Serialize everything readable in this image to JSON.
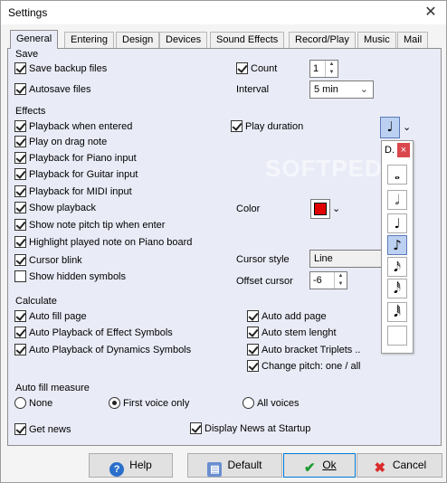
{
  "window": {
    "title": "Settings"
  },
  "tabs": [
    "General",
    "Entering",
    "Design",
    "Devices",
    "Sound Effects",
    "Record/Play",
    "Music",
    "Mail"
  ],
  "save": {
    "heading": "Save",
    "backup_label": "Save backup files",
    "count_label": "Count",
    "count_value": "1",
    "autosave_label": "Autosave files",
    "interval_label": "Interval",
    "interval_value": "5 min"
  },
  "effects": {
    "heading": "Effects",
    "items": [
      "Playback when entered",
      "Play on drag note",
      "Playback for Piano input",
      "Playback for Guitar input",
      "Playback for MIDI input",
      "Show playback",
      "Show note pitch tip when enter",
      "Highlight played note on Piano board",
      "Cursor blink",
      "Show hidden symbols"
    ],
    "play_duration_label": "Play duration",
    "color_label": "Color",
    "color_value": "#e00000",
    "cursor_style_label": "Cursor style",
    "cursor_style_value": "Line",
    "offset_cursor_label": "Offset cursor",
    "offset_cursor_value": "-6"
  },
  "note_popup": {
    "header": "D.",
    "close_glyph": "×",
    "notes": [
      "𝅝",
      "𝅗𝅥",
      "♩",
      "♪",
      "𝅘𝅥𝅯",
      "𝅘𝅥𝅰",
      "𝅘𝅥𝅱"
    ],
    "selected_note": "♩"
  },
  "calculate": {
    "heading": "Calculate",
    "left": [
      "Auto fill page",
      "Auto Playback of Effect Symbols",
      "Auto Playback of Dynamics Symbols"
    ],
    "right": [
      "Auto add page",
      "Auto stem lenght",
      "Auto bracket Triplets ..",
      "Change pitch: one / all"
    ]
  },
  "auto_fill": {
    "heading": "Auto fill measure",
    "options": [
      "None",
      "First voice only",
      "All voices"
    ],
    "selected": "First voice only"
  },
  "news": {
    "get_news": "Get news",
    "display_news": "Display News at Startup"
  },
  "buttons": {
    "help": "Help",
    "default": "Default",
    "ok": "Ok",
    "cancel": "Cancel"
  },
  "watermark": "SOFTPEDIA"
}
